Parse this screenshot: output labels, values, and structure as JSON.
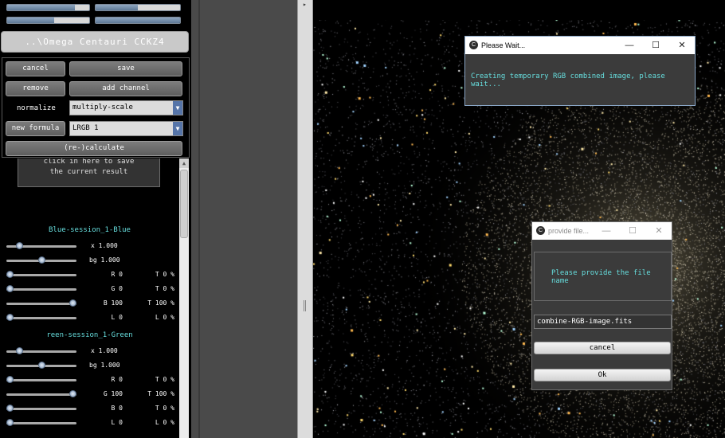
{
  "progress_bars": [
    {
      "fraction": 0.83
    },
    {
      "fraction": 0.5
    },
    {
      "fraction": 0.57
    },
    {
      "fraction": 1.0
    }
  ],
  "header": {
    "title": "..\\Omega Centauri CCKZ4"
  },
  "controls": {
    "cancel_label": "cancel",
    "save_label": "save",
    "remove_label": "remove",
    "add_channel_label": "add channel",
    "normalize_label": "normalize",
    "normalize_value": "multiply-scale",
    "new_formula_label": "new formula",
    "formula_value": "LRGB 1",
    "calculate_label": "(re-)calculate"
  },
  "info_box": {
    "line1": "click in here to save",
    "line2": "the current result"
  },
  "channels": [
    {
      "title": "Blue-session_1-Blue",
      "x_label": "x 1.000",
      "x_value": 0.15,
      "bg_label": "bg 1.000",
      "bg_value": 0.5,
      "rows": [
        {
          "label": "R 0",
          "t_label": "T 0 %",
          "value": 0.0
        },
        {
          "label": "G 0",
          "t_label": "T 0 %",
          "value": 0.0
        },
        {
          "label": "B 100",
          "t_label": "T 100 %",
          "value": 1.0
        },
        {
          "label": "L 0",
          "t_label": "L 0 %",
          "value": 0.0
        }
      ]
    },
    {
      "title": "reen-session_1-Green",
      "x_label": "x 1.000",
      "x_value": 0.15,
      "bg_label": "bg 1.000",
      "bg_value": 0.5,
      "rows": [
        {
          "label": "R 0",
          "t_label": "T 0 %",
          "value": 0.0
        },
        {
          "label": "G 100",
          "t_label": "T 100 %",
          "value": 1.0
        },
        {
          "label": "B 0",
          "t_label": "T 0 %",
          "value": 0.0
        },
        {
          "label": "L 0",
          "t_label": "L 0 %",
          "value": 0.0
        }
      ]
    }
  ],
  "wait_dialog": {
    "title": "Please Wait...",
    "message": "Creating temporary RGB combined image, please wait..."
  },
  "file_dialog": {
    "title": "provide file...",
    "message": "Please provide the file name",
    "filename": "combine-RGB-image.fits",
    "cancel_label": "cancel",
    "ok_label": "Ok"
  },
  "window_buttons": {
    "minimize": "—",
    "maximize": "☐",
    "close": "✕"
  },
  "colors": {
    "accent_cyan": "#66dddd",
    "panel_gray": "#4a4a4a",
    "slider_blue": "#7d95b3"
  }
}
